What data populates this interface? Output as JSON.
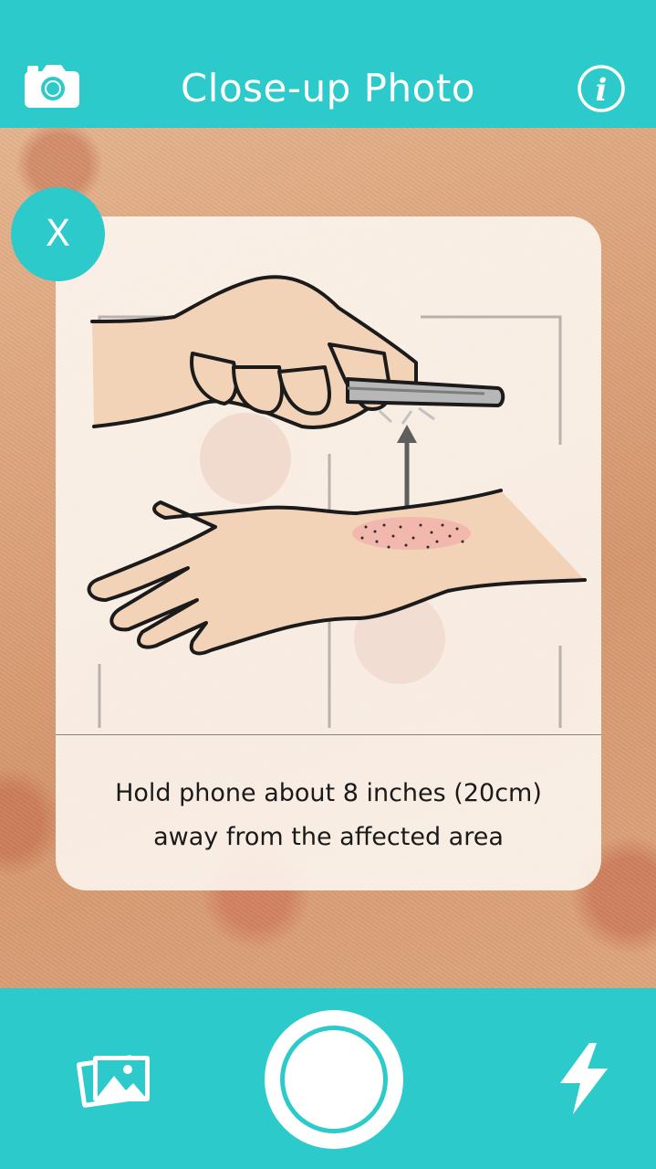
{
  "header": {
    "title": "Close-up Photo",
    "left_icon": "camera-icon",
    "right_icon": "info-icon"
  },
  "instruction": {
    "close_label": "X",
    "caption_line1": "Hold phone about 8 inches (20cm)",
    "caption_line2": "away from the affected area"
  },
  "bottom_bar": {
    "left_icon": "gallery-icon",
    "center": "shutter-button",
    "right_icon": "flash-icon"
  },
  "colors": {
    "accent": "#2ccaca",
    "white": "#ffffff",
    "caption_text": "#1a1a1a"
  }
}
